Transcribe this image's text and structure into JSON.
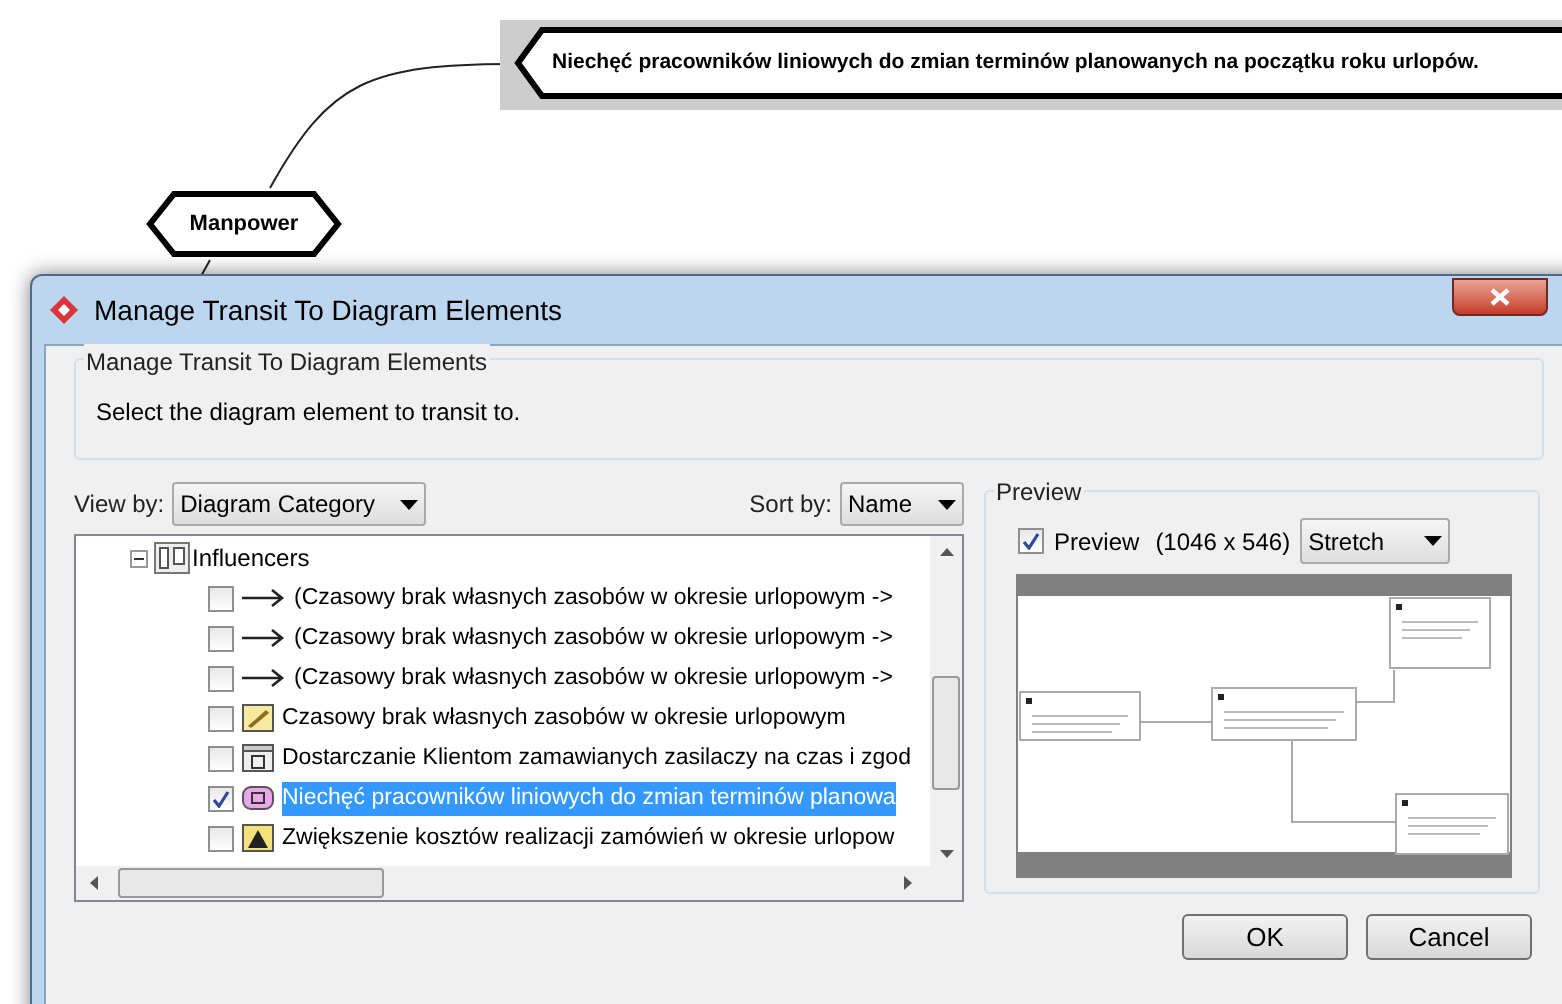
{
  "diagram": {
    "callout": "Niechęć pracowników liniowych do zmian terminów planowanych na początku roku urlopów.",
    "node": "Manpower"
  },
  "dialog": {
    "title": "Manage Transit To Diagram Elements",
    "group_title": "Manage Transit To Diagram Elements",
    "instruction": "Select the diagram element to transit to.",
    "view_by": {
      "label": "View by:",
      "value": "Diagram Category"
    },
    "sort_by": {
      "label": "Sort by:",
      "value": "Name"
    },
    "tree": {
      "label": "Influencers",
      "expanded": true,
      "children": [
        {
          "kind": "transition",
          "label": "(Czasowy brak własnych zasobów w okresie urlopowym ->",
          "checked": false,
          "selected": false
        },
        {
          "kind": "transition",
          "label": "(Czasowy brak własnych zasobów w okresie urlopowym ->",
          "checked": false,
          "selected": false
        },
        {
          "kind": "transition",
          "label": "(Czasowy brak własnych zasobów w okresie urlopowym ->",
          "checked": false,
          "selected": false
        },
        {
          "kind": "note",
          "label": "Czasowy brak własnych zasobów w okresie urlopowym",
          "checked": false,
          "selected": false
        },
        {
          "kind": "goal",
          "label": "Dostarczanie Klientom zamawianych zasilaczy na czas i zgod",
          "checked": false,
          "selected": false
        },
        {
          "kind": "influencer",
          "label": "Niechęć pracowników liniowych do zmian terminów planowa",
          "checked": true,
          "selected": true
        },
        {
          "kind": "risk",
          "label": "Zwiększenie kosztów realizacji zamówień w okresie urlopow",
          "checked": false,
          "selected": false
        }
      ]
    },
    "preview": {
      "group_title": "Preview",
      "checkbox_label": "Preview",
      "checked": true,
      "size": "(1046 x 546)",
      "scale": "Stretch"
    },
    "buttons": [
      "OK",
      "Cancel"
    ]
  }
}
